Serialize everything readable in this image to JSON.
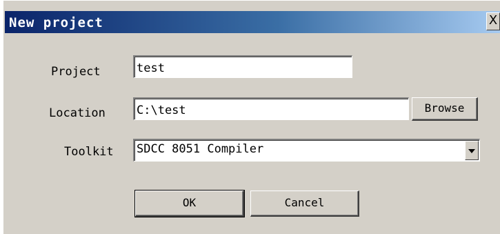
{
  "dialog": {
    "title": "New project",
    "close_glyph": "X"
  },
  "form": {
    "project_label": "Project",
    "project_value": "test",
    "location_label": "Location",
    "location_value": "C:\\test",
    "browse_label": "Browse",
    "toolkit_label": "Toolkit",
    "toolkit_value": "SDCC 8051 Compiler"
  },
  "actions": {
    "ok_label": "OK",
    "cancel_label": "Cancel"
  },
  "colors": {
    "face": "#d4d0c8",
    "titlebar_start": "#0a246a",
    "titlebar_end": "#a6caf0"
  },
  "icons": {
    "close": "close-icon",
    "dropdown": "chevron-down-icon"
  }
}
